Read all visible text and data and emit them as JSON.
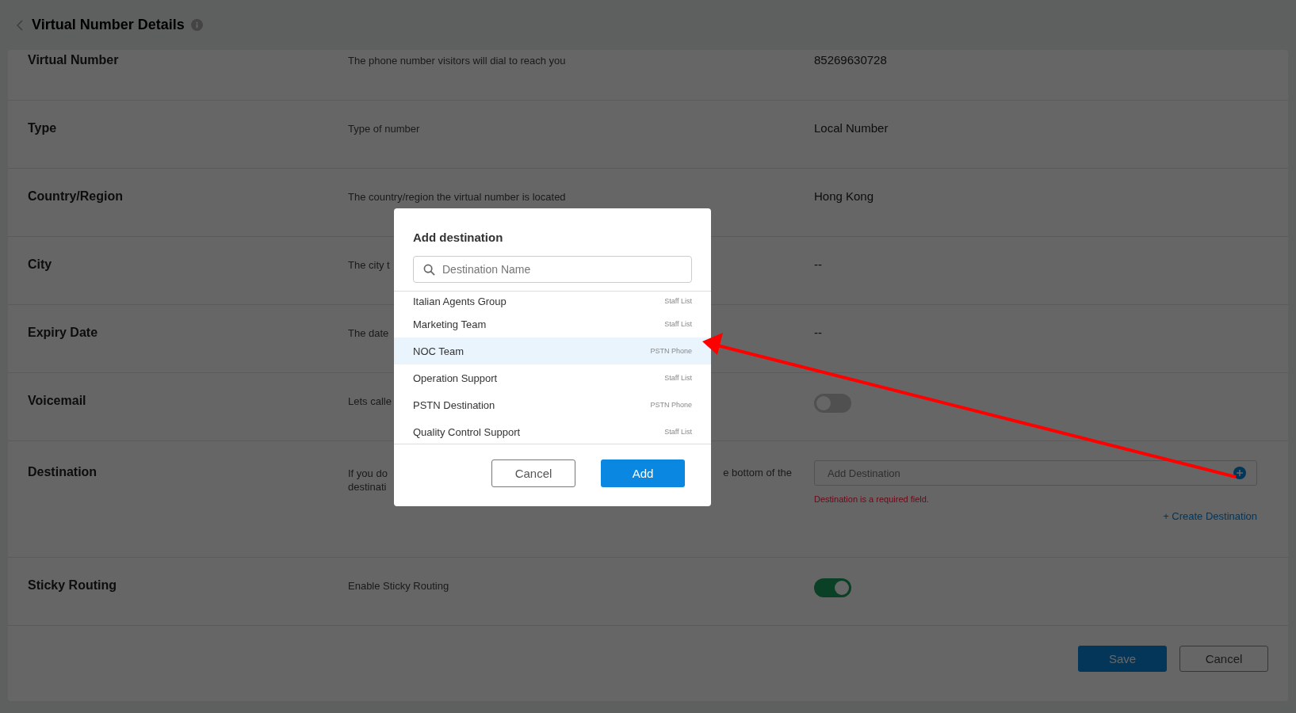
{
  "header": {
    "title": "Virtual Number Details"
  },
  "rows": [
    {
      "kind": "text",
      "label": "Virtual Number",
      "description": "The phone number visitors will dial to reach you",
      "value": "85269630728"
    },
    {
      "kind": "text",
      "label": "Type",
      "description": "Type of number",
      "value": "Local Number"
    },
    {
      "kind": "text",
      "label": "Country/Region",
      "description": "The country/region the virtual number is located",
      "value": "Hong Kong"
    },
    {
      "kind": "text",
      "label": "City",
      "description": "The city t",
      "value": "--"
    },
    {
      "kind": "text",
      "label": "Expiry Date",
      "description": "The date",
      "value": "--"
    },
    {
      "kind": "toggle",
      "label": "Voicemail",
      "description": "Lets calle",
      "on": false
    },
    {
      "kind": "destination",
      "label": "Destination",
      "description_lines": [
        "If you do",
        "destinati"
      ],
      "description_tail": "e bottom of the",
      "placeholder": "Add Destination",
      "error": "Destination is a required field.",
      "link": "+ Create Destination"
    },
    {
      "kind": "toggle",
      "label": "Sticky Routing",
      "description": "Enable Sticky Routing",
      "on": true
    }
  ],
  "footer_buttons": [
    {
      "kind": "primary",
      "label": "Save"
    },
    {
      "kind": "secondary",
      "label": "Cancel"
    }
  ],
  "dialog": {
    "title": "Add destination",
    "search": {
      "placeholder": "Destination Name"
    },
    "items": [
      {
        "name": "Italian Agents Group",
        "type": "Staff List",
        "selected": false
      },
      {
        "name": "Marketing Team",
        "type": "Staff List",
        "selected": false
      },
      {
        "name": "NOC Team",
        "type": "PSTN Phone",
        "selected": true
      },
      {
        "name": "Operation Support",
        "type": "Staff List",
        "selected": false
      },
      {
        "name": "PSTN Destination",
        "type": "PSTN Phone",
        "selected": false
      },
      {
        "name": "Quality Control Support",
        "type": "Staff List",
        "selected": false
      }
    ],
    "buttons": [
      {
        "kind": "secondary",
        "label": "Cancel"
      },
      {
        "kind": "primary",
        "label": "Add"
      }
    ]
  }
}
